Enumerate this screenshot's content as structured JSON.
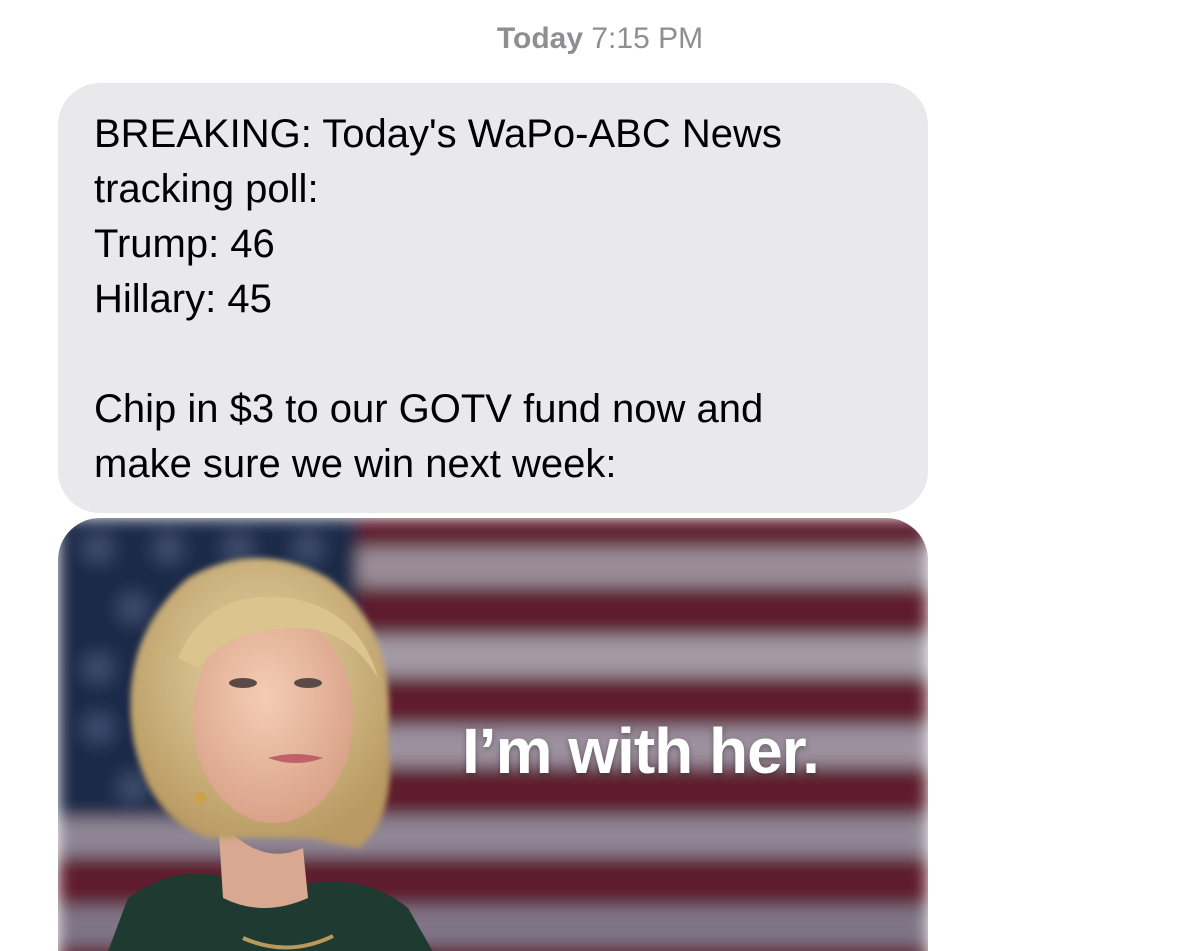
{
  "header": {
    "day": "Today",
    "time": "7:15 PM"
  },
  "message": {
    "lines": [
      "BREAKING: Today's WaPo-ABC News",
      "tracking poll:",
      "Trump: 46",
      "Hillary: 45",
      "",
      "Chip in $3 to our GOTV fund now and",
      "make sure we win next week:"
    ]
  },
  "image": {
    "slogan": "I’m with her."
  },
  "colors": {
    "bubble_background": "#e9e9eb",
    "timestamp_gray": "#8e8e93",
    "flag_red": "#7a1a2c",
    "flag_navy": "#1c2a4a"
  }
}
